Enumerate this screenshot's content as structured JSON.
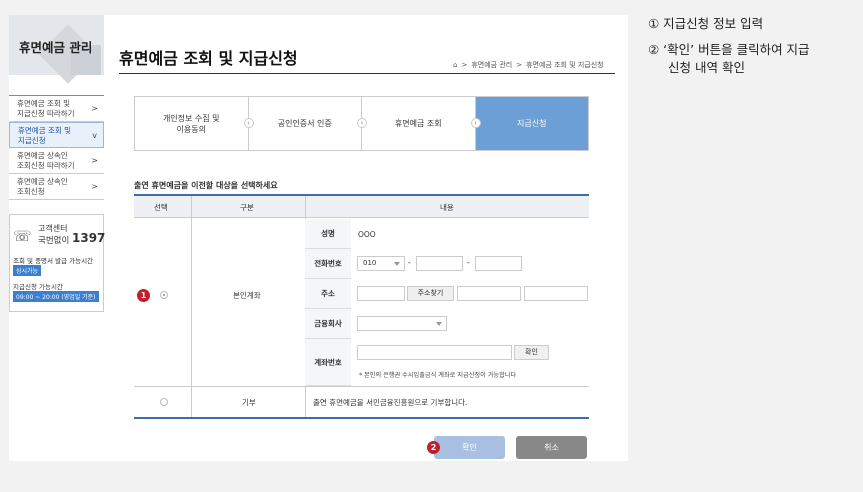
{
  "sidebar": {
    "title": "휴면예금 관리",
    "items": [
      {
        "label1": "휴면예금 조회 및",
        "label2": "지급신청 따라하기",
        "arrow": ">"
      },
      {
        "label1": "휴면예금 조회 및",
        "label2": "지급신청",
        "arrow": "v"
      },
      {
        "label1": "휴면예금 상속인",
        "label2": "조회신청 따라하기",
        "arrow": ">"
      },
      {
        "label1": "휴면예금 상속인",
        "label2": "조회신청",
        "arrow": ">"
      }
    ],
    "cs": {
      "title": "고객센터",
      "sub": "국번없이",
      "number": "1397",
      "line1": "조회 및 증명서 발급 가능시간",
      "badge1": "상시가능",
      "line2": "지급신청 가능시간",
      "badge2": "09:00 ~ 20:00 (영업일 기준)"
    }
  },
  "header": {
    "title": "휴면예금 조회 및 지급신청",
    "breadcrumb": [
      "휴면예금 관리",
      "휴면예금 조회 및 지급신청"
    ],
    "breadcrumb_sep": ">"
  },
  "steps": [
    {
      "label1": "개인정보 수집 및",
      "label2": "이용동의"
    },
    {
      "label1": "공인인증서 인증",
      "label2": ""
    },
    {
      "label1": "휴면예금 조회",
      "label2": ""
    },
    {
      "label1": "지급신청",
      "label2": ""
    }
  ],
  "form": {
    "section_title": "출연 휴면예금을 이전할 대상을 선택하세요",
    "headers": {
      "select": "선택",
      "type": "구분",
      "content": "내용"
    },
    "own_account": "본인계좌",
    "fields": {
      "name_label": "성명",
      "name_value": "OOO",
      "phone_label": "전화번호",
      "phone_prefix": "010",
      "dash": "-",
      "address_label": "주소",
      "address_button": "주소찾기",
      "bank_label": "금융회사",
      "account_label": "계좌번호",
      "account_button": "확인",
      "account_note": "* 본인의 은행권 수시입출금식 계좌로 지급신청이 가능합니다"
    },
    "donation_label": "기부",
    "donation_text": "출연 휴면예금을 서민금융진흥원으로 기부합니다."
  },
  "buttons": {
    "confirm": "확인",
    "cancel": "취소"
  },
  "markers": {
    "m1": "1",
    "m2": "2"
  },
  "instructions": {
    "step1": "① 지급신청 정보 입력",
    "step2_line1": "② ‘확인’ 버튼을 클릭하여 지급",
    "step2_line2": "신청 내역 확인"
  },
  "colors": {
    "accent": "#6b9fd5",
    "table_border": "#3c6eaa",
    "marker": "#c0202a"
  }
}
